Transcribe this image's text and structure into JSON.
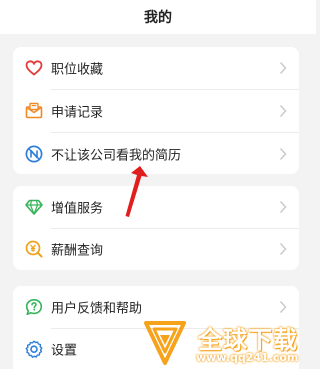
{
  "header": {
    "title": "我的"
  },
  "section1": {
    "items": [
      {
        "label": "职位收藏",
        "icon": "heart-icon"
      },
      {
        "label": "申请记录",
        "icon": "envelope-icon"
      },
      {
        "label": "不让该公司看我的简历",
        "icon": "block-n-icon"
      }
    ]
  },
  "section2": {
    "items": [
      {
        "label": "增值服务",
        "icon": "diamond-icon"
      },
      {
        "label": "薪酬查询",
        "icon": "yuan-search-icon"
      }
    ]
  },
  "section3": {
    "items": [
      {
        "label": "用户反馈和帮助",
        "icon": "question-bubble-icon"
      },
      {
        "label": "设置",
        "icon": "gear-icon"
      }
    ]
  },
  "watermark": {
    "name": "全球下载",
    "url": "www.qq241.com"
  },
  "colors": {
    "red": "#e33b3b",
    "orange": "#f08a24",
    "blue": "#2f7fd8",
    "green": "#35b35a",
    "yellow": "#f0a21b",
    "annotation": "#e01e1e",
    "watermark": "#f7a21b"
  }
}
